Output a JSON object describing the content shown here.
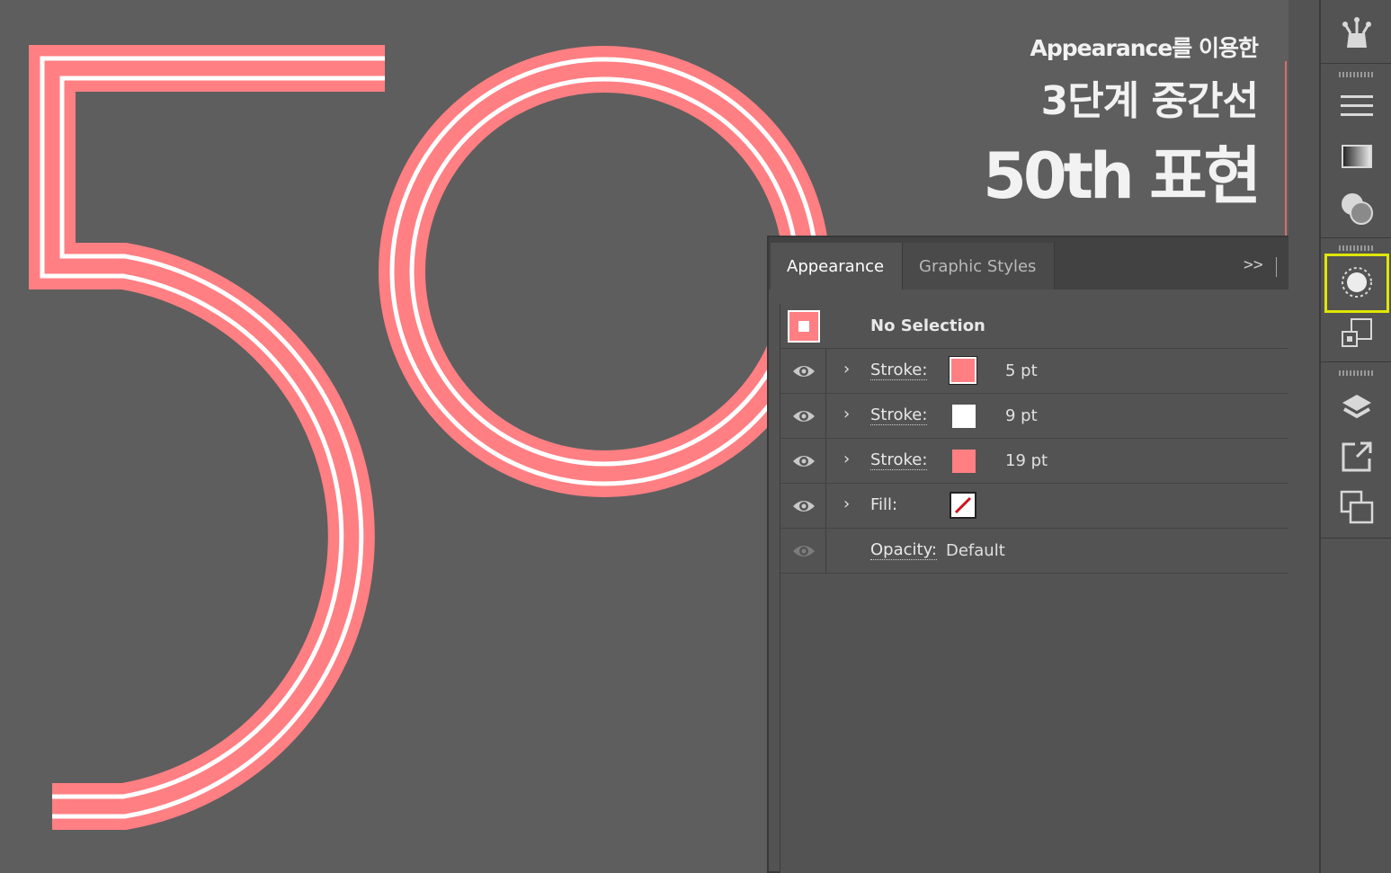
{
  "artwork": {
    "heading_line1": "Appearance를 이용한",
    "heading_line2": "3단계 중간선",
    "heading_line3": "50th 표현",
    "colors": {
      "pink": "#ff7f83",
      "white": "#ffffff",
      "canvas": "#5e5e5e"
    }
  },
  "panel": {
    "tabs": [
      {
        "label": "Appearance",
        "active": true
      },
      {
        "label": "Graphic Styles",
        "active": false
      }
    ],
    "expand_label": ">>",
    "header_row": {
      "label": "No Selection",
      "icon": "object-thumbnail-icon"
    },
    "rows": [
      {
        "label": "Stroke:",
        "value": "5 pt",
        "swatch_color": "#ff7f83",
        "visible": true
      },
      {
        "label": "Stroke:",
        "value": "9 pt",
        "swatch_color": "#ffffff",
        "visible": true
      },
      {
        "label": "Stroke:",
        "value": "19 pt",
        "swatch_color": "#ff7f83",
        "visible": true
      },
      {
        "label": "Fill:",
        "value": "",
        "swatch_color": "none",
        "visible": true
      },
      {
        "label": "Opacity:",
        "value": "Default",
        "visible": false
      }
    ]
  },
  "dock": {
    "icons": [
      "puppet-warp-icon",
      "align-icon",
      "gradient-icon",
      "transparency-icon",
      "appearance-icon",
      "asset-export-icon",
      "layers-icon",
      "export-icon",
      "artboards-icon"
    ],
    "highlight_color": "#e0e600"
  }
}
